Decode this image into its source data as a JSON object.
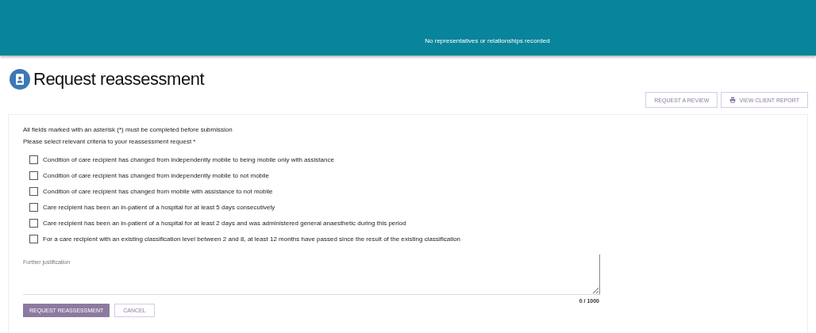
{
  "banner": {
    "message": "No representatives or relationships recorded"
  },
  "page": {
    "title": "Request reassessment"
  },
  "actions": [
    "REQUEST A REVIEW",
    "VIEW CLIENT REPORT"
  ],
  "form": {
    "notes": [
      "All fields marked with an asterisk (*) must be completed before submission",
      "Please select relevant criteria to your reassessment request *"
    ],
    "criteria": [
      {
        "label": "Condition of care recipient has changed from independently mobile to being mobile only with assistance",
        "checked": false
      },
      {
        "label": "Condition of care recipient has changed from independently mobile to not mobile",
        "checked": false
      },
      {
        "label": "Condition of care recipient has changed from mobile with assistance to not mobile",
        "checked": false
      },
      {
        "label": "Care recipient has been an in-patient of a hospital for at least 5 days consecutively",
        "checked": false
      },
      {
        "label": "Care recipient has been an in-patient of a hospital for at least 2 days and was administered general anaesthetic during this period",
        "checked": false
      },
      {
        "label": "For a care recipient with an existing classification level between 2 and 8, at least 12 months have passed since the result of the existing classification",
        "checked": false
      }
    ],
    "justification": {
      "placeholder": "Further justification",
      "counter": "0 / 1000"
    },
    "buttons": [
      "REQUEST REASSESSMENT",
      "CANCEL"
    ]
  }
}
